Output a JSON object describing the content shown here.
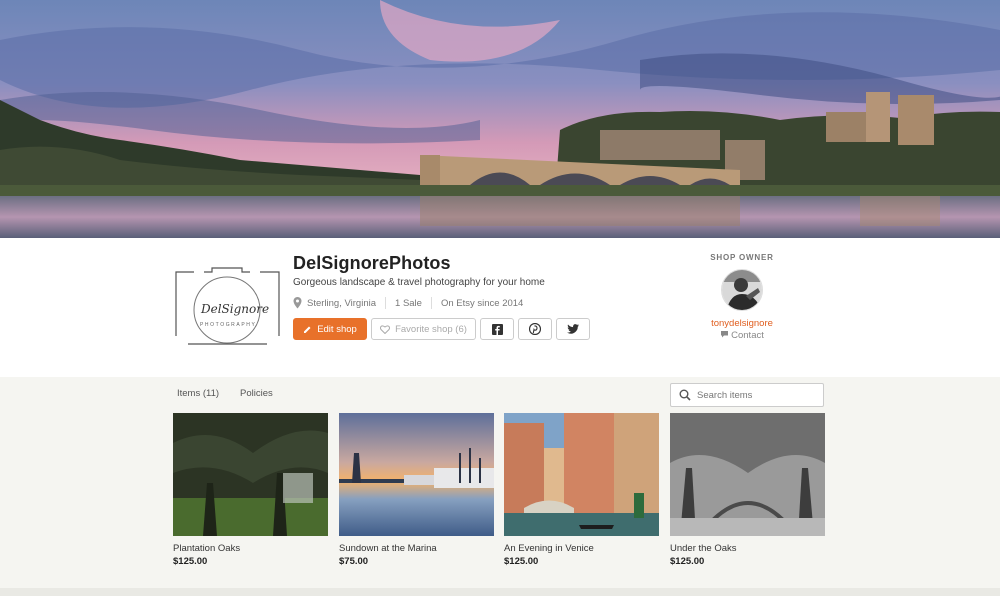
{
  "shop": {
    "name": "DelSignorePhotos",
    "tagline": "Gorgeous landscape & travel photography for your home",
    "location": "Sterling, Virginia",
    "sales": "1 Sale",
    "since": "On Etsy since 2014",
    "logo_text": "DelSignore",
    "logo_subtext": "PHOTOGRAPHY"
  },
  "actions": {
    "edit_label": "Edit shop",
    "favorite_label": "Favorite shop (6)",
    "facebook_icon": "facebook-icon",
    "pinterest_icon": "pinterest-icon",
    "twitter_icon": "twitter-icon"
  },
  "owner": {
    "label": "SHOP OWNER",
    "username": "tonydelsignore",
    "contact": "Contact"
  },
  "tabs": [
    {
      "label": "Items (11)"
    },
    {
      "label": "Policies"
    }
  ],
  "search": {
    "placeholder": "Search items"
  },
  "listings": [
    {
      "title": "Plantation Oaks",
      "price": "$125.00"
    },
    {
      "title": "Sundown at the Marina",
      "price": "$75.00"
    },
    {
      "title": "An Evening in Venice",
      "price": "$125.00"
    },
    {
      "title": "Under the Oaks",
      "price": "$125.00"
    }
  ],
  "colors": {
    "accent": "#e8712a",
    "link": "#e05e1f"
  }
}
